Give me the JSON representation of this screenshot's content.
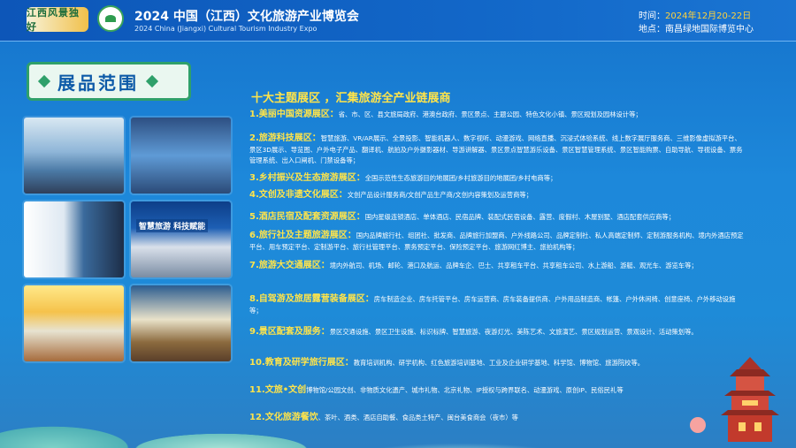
{
  "header": {
    "logo_text": "江西风景独好",
    "title_cn": "2024 中国（江西）文化旅游产业博览会",
    "title_en": "2024 China (Jiangxi) Cultural Tourism Industry Expo",
    "time_label": "时间：",
    "time_value": "2024年12月20-22日",
    "place_label": "地点：",
    "place_value": "南昌绿地国际博览中心"
  },
  "badge": {
    "title": "展品范围"
  },
  "photos": [
    {
      "caption": ""
    },
    {
      "caption": ""
    },
    {
      "caption": ""
    },
    {
      "caption": "智慧旅游 科技赋能"
    },
    {
      "caption": ""
    },
    {
      "caption": ""
    }
  ],
  "main": {
    "title": "十大主题展区 ，汇集旅游全产业链展商",
    "items": [
      {
        "head": "1.美丽中国资源展区：",
        "body": "省、市、区、县文旅局政府、港澳台政府、景区景点、主题公园、特色文化小镇、景区规划及园林设计等；"
      },
      {
        "head": "2.旅游科技展区：",
        "body": "智慧旅游、VR/AR展示、全景投影、智能机器人、数字视听、动漫游戏、网络直播、沉浸式体验系统、线上数字展厅服务商、三维影像虚拟游平台、景区3D展示、导览图、户外电子产品、翻译机、航拍及户外摄影器材、导游讲解器、景区景点智慧游乐设备、景区智慧管理系统、景区智能购票、自助导航、导视设备、票务管理系统、出入口闸机、门禁设备等；"
      },
      {
        "head": "3.乡村振兴及生态旅游展区：",
        "body": "全国示范性生态旅游目的地展团/乡村旅游目的地展团/乡村电商等；"
      },
      {
        "head": "4.文创及非遗文化展区：",
        "body": "文创产品设计服务商/文创产品生产商/文创内容策划及运营商等；"
      },
      {
        "head": "5.酒店民宿及配套资源展区：",
        "body": "国内星级连锁酒店、单体酒店、民宿品牌、装配式民宿设备、露营、度假村、木屋别墅、酒店配套供应商等；"
      },
      {
        "head": "6.旅行社及主题旅游展区：",
        "body": "国内品牌旅行社、组团社、批发商、品牌旅行加盟商、户外线路公司、品牌定制社、私人高端定制师、定制游服务机构、境内外酒店预定平台、用车预定平台、定制游平台、旅行社管理平台、票务预定平台、保险预定平台、旅游网红博主、旅拍机构等；"
      },
      {
        "head": "7.旅游大交通展区：",
        "body": "境内外航司、机场、邮轮、港口及航运、品牌车企、巴士、共享租车平台、共享租车公司、水上游船、游艇、观光车、游览车等；"
      },
      {
        "head": "8.自驾游及旅居露营装备展区：",
        "body": "房车制造企业、房车托管平台、房车运营商、房车装备提供商、户外用品制造商、帐篷、户外休闲椅、创意座椅、户外移动设施等；"
      },
      {
        "head": "9.景区配套及服务：",
        "body": "景区交通设施、景区卫生设施、标识标牌、智慧旅游、夜游灯光、美陈艺术、文旅演艺、景区规划运营、景观设计、活动策划等。"
      },
      {
        "head": "10.教育及研学旅行展区：",
        "body": "教育培训机构、研学机构、红色旅游培训基地、工业及企业研学基地、科学馆、博物馆、旅游院校等。"
      },
      {
        "head": "11.文旅•文创",
        "body": "博物馆/公园文创、非物质文化遗产、城市礼物、北京礼物、IP授权与跨界联名、动漫游戏、原创IP、民俗民礼等"
      },
      {
        "head": "12.文化旅游餐饮",
        "body": "、茶叶、酒类、酒店自助餐、食品类土特产、闽台美食商会（夜市）等"
      }
    ]
  },
  "colors": {
    "accent_yellow": "#ffe44a",
    "header_blue": "#0d56b8",
    "badge_green": "#2fa06a"
  }
}
